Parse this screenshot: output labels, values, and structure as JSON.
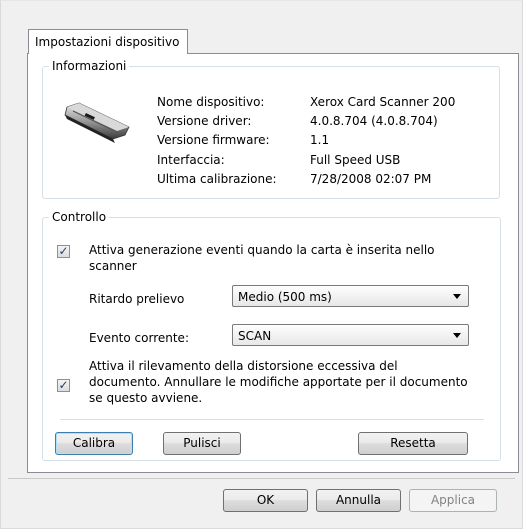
{
  "tabs": [
    {
      "label": "Impostazioni dispositivo"
    }
  ],
  "info": {
    "title": "Informazioni",
    "rows": [
      {
        "label": "Nome dispositivo:",
        "value": "Xerox Card Scanner 200"
      },
      {
        "label": "Versione driver:",
        "value": "4.0.8.704 (4.0.8.704)"
      },
      {
        "label": "Versione firmware:",
        "value": "1.1"
      },
      {
        "label": "Interfaccia:",
        "value": "Full Speed USB"
      },
      {
        "label": "Ultima calibrazione:",
        "value": "7/28/2008  02:07 PM"
      }
    ]
  },
  "control": {
    "title": "Controllo",
    "event_checkbox": {
      "checked": true,
      "line1": "Attiva generazione eventi quando la carta è inserita nello",
      "line2": "scanner"
    },
    "pick_delay": {
      "label": "Ritardo prelievo",
      "value": "Medio (500 ms)"
    },
    "current_event": {
      "label": "Evento corrente:",
      "value": "SCAN"
    },
    "skew_checkbox": {
      "checked": true,
      "line1": "Attiva il rilevamento della distorsione eccessiva del",
      "line2": "documento. Annullare le modifiche apportate per il documento",
      "line3": "se questo avviene."
    },
    "buttons": {
      "calibrate": "Calibra",
      "clean": "Pulisci",
      "reset": "Resetta"
    }
  },
  "footer": {
    "ok": "OK",
    "cancel": "Annulla",
    "apply": "Applica"
  },
  "icons": {
    "check": "✓"
  },
  "colors": {
    "panel_border": "#898c95",
    "focus_border": "#3c7fb1",
    "disabled_text": "#838383"
  }
}
